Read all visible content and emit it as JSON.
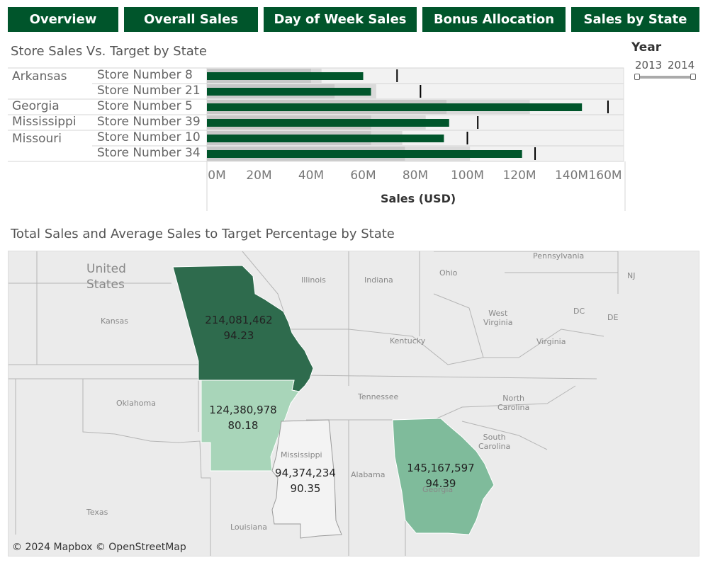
{
  "nav": [
    {
      "label": "Overview"
    },
    {
      "label": "Overall Sales"
    },
    {
      "label": "Day of Week Sales"
    },
    {
      "label": "Bonus Allocation"
    },
    {
      "label": "Sales by State"
    }
  ],
  "bullet_title": "Store Sales Vs. Target by State",
  "year_filter": {
    "title": "Year",
    "start": "2013",
    "end": "2014"
  },
  "map_title": "Total Sales and Average Sales to Target Percentage by State",
  "colors": {
    "nav_bg": "#00552b",
    "bar": "#00552b",
    "band_dark": "#c8c8c8",
    "band_light": "#dadada",
    "target_line": "#000000"
  },
  "chart_data": {
    "type": "bar",
    "orientation": "horizontal",
    "groups": [
      "Arkansas",
      "Georgia",
      "Mississippi",
      "Missouri"
    ],
    "rows": [
      {
        "state": "Arkansas",
        "store": "Store Number 8",
        "sales": 60,
        "target": 73,
        "band_inner": 40,
        "band_outer": 44
      },
      {
        "state": "",
        "store": "Store Number 21",
        "sales": 63,
        "target": 82,
        "band_inner": 49,
        "band_outer": 65
      },
      {
        "state": "Georgia",
        "store": "Store Number 5",
        "sales": 144,
        "target": 154,
        "band_inner": 92,
        "band_outer": 124
      },
      {
        "state": "Mississippi",
        "store": "Store Number 39",
        "sales": 93,
        "target": 104,
        "band_inner": 63,
        "band_outer": 84
      },
      {
        "state": "Missouri",
        "store": "Store Number 10",
        "sales": 91,
        "target": 100,
        "band_inner": 63,
        "band_outer": 75
      },
      {
        "state": "",
        "store": "Store Number 34",
        "sales": 121,
        "target": 126,
        "band_inner": 76,
        "band_outer": 101
      }
    ],
    "xlabel": "Sales (USD)",
    "xticks": [
      "0M",
      "20M",
      "40M",
      "60M",
      "80M",
      "100M",
      "120M",
      "140M",
      "160M"
    ],
    "xlim": [
      0,
      160
    ],
    "units": "millions USD"
  },
  "map": {
    "states": [
      {
        "name": "Missouri",
        "sales": "214,081,462",
        "pct": "94.23",
        "color": "#2e6b4d"
      },
      {
        "name": "Arkansas",
        "sales": "124,380,978",
        "pct": "80.18",
        "color": "#a8d5b9"
      },
      {
        "name": "Mississippi",
        "sales": "94,374,234",
        "pct": "90.35",
        "color": "#f3f3f3"
      },
      {
        "name": "Georgia",
        "sales": "145,167,597",
        "pct": "94.39",
        "color": "#7fbb9b"
      }
    ],
    "labels": {
      "united_states": "United\nStates",
      "kansas": "Kansas",
      "oklahoma": "Oklahoma",
      "texas": "Texas",
      "louisiana": "Louisiana",
      "illinois": "Illinois",
      "indiana": "Indiana",
      "ohio": "Ohio",
      "pennsylvania": "Pennsylvania",
      "nj": "NJ",
      "dc": "DC",
      "de": "DE",
      "west_virginia": "West\nVirginia",
      "virginia": "Virginia",
      "kentucky": "Kentucky",
      "tennessee": "Tennessee",
      "north_carolina": "North\nCarolina",
      "south_carolina": "South\nCarolina",
      "alabama": "Alabama",
      "mississippi": "Mississippi",
      "georgia": "Georgia"
    },
    "attribution": "© 2024 Mapbox © OpenStreetMap"
  }
}
